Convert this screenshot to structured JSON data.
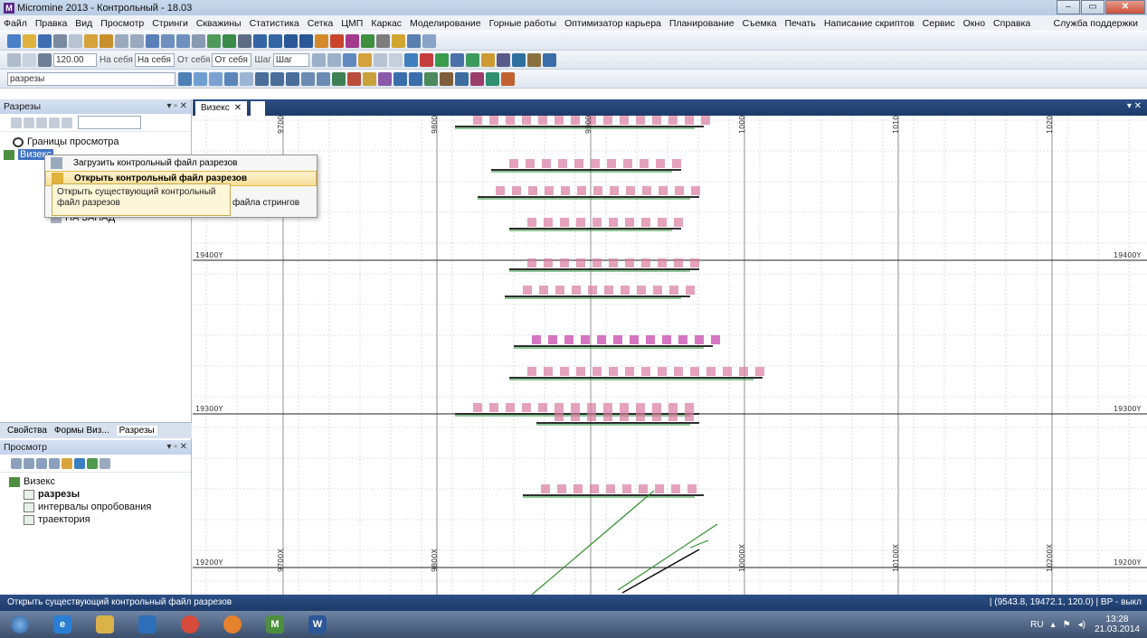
{
  "app": {
    "title": "Micromine 2013 - Контрольный - 18.03",
    "logo_letter": "M",
    "window_buttons": [
      "–",
      "▭",
      "✕"
    ]
  },
  "menu": {
    "items": [
      "Файл",
      "Правка",
      "Вид",
      "Просмотр",
      "Стринги",
      "Скважины",
      "Статистика",
      "Сетка",
      "ЦМП",
      "Каркас",
      "Моделирование",
      "Горные работы",
      "Оптимизатор карьера",
      "Планирование",
      "Съемка",
      "Печать",
      "Написание скриптов",
      "Сервис",
      "Окно",
      "Справка"
    ],
    "support": "Служба поддержки"
  },
  "toolbar2": {
    "value_field": "120.00",
    "from_self_1": "На себя",
    "from_self_2": "На себя",
    "away_1": "От себя",
    "away_2": "От себя",
    "step_1": "Шаг",
    "step_2": "Шаг"
  },
  "toolbar3": {
    "layer_select": "разрезы"
  },
  "sections_panel": {
    "title": "Разрезы",
    "tree": [
      "Границы просмотра",
      "Визекс",
      "НА ЗАПАД"
    ]
  },
  "context_menu": {
    "items": [
      "Загрузить контрольный файл разрезов",
      "Открыть контрольный файл разрезов"
    ],
    "behind_text": "файла стрингов",
    "tooltip": "Открыть существующий контрольный файл разрезов"
  },
  "panel_tabs": [
    "Свойства",
    "Формы Виз...",
    "Разрезы"
  ],
  "view_panel": {
    "title": "Просмотр",
    "tree": [
      "Визекс",
      "разрезы",
      "интервалы опробования",
      "траектория"
    ]
  },
  "document": {
    "tab": "Визекс",
    "x_ticks": [
      "9700X",
      "9800X",
      "9900X",
      "10000X",
      "10100X",
      "10200X"
    ],
    "y_ticks": [
      "19400Y",
      "19300Y",
      "19200Y"
    ]
  },
  "status": {
    "left": "Открыть существующий контрольный файл разрезов",
    "right": "| (9543.8, 19472.1, 120.0) | ВР - выкл"
  },
  "taskbar": {
    "lang": "RU",
    "time": "13:28",
    "date": "21.03.2014"
  }
}
